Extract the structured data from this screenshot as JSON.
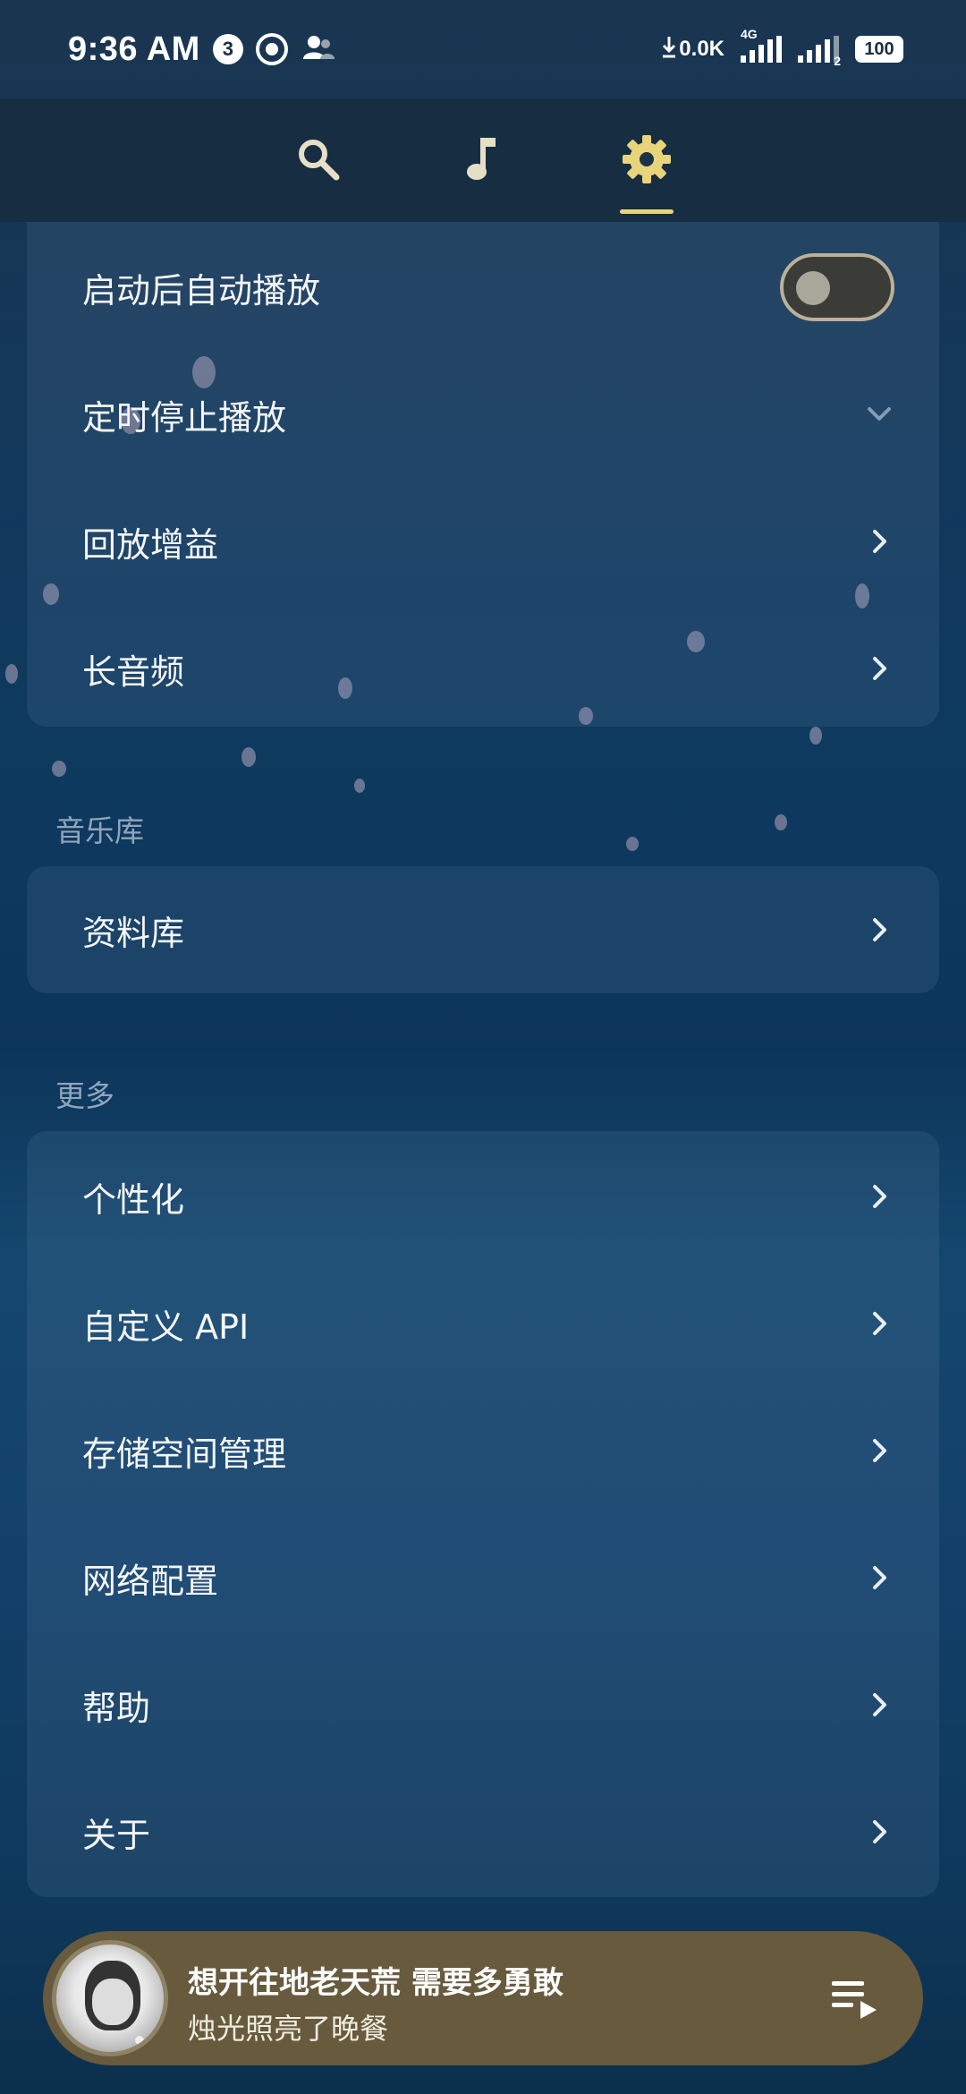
{
  "status_bar": {
    "time": "9:36 AM",
    "notification_count": "3",
    "network_speed": "0.0K",
    "network_type": "4G",
    "sim_slot": "2",
    "battery": "100"
  },
  "nav": {
    "tabs": [
      {
        "name": "search",
        "icon": "search-icon"
      },
      {
        "name": "music",
        "icon": "music-note-icon"
      },
      {
        "name": "settings",
        "icon": "gear-icon",
        "active": true
      }
    ],
    "active_color": "#e8d47a",
    "inactive_color": "#e6dfc6"
  },
  "playback_card": {
    "items": [
      {
        "label": "启动后自动播放",
        "control": "toggle",
        "checked": false
      },
      {
        "label": "定时停止播放",
        "control": "dropdown"
      },
      {
        "label": "回放增益",
        "control": "chevron"
      },
      {
        "label": "长音频",
        "control": "chevron"
      }
    ]
  },
  "library_section": {
    "title": "音乐库",
    "items": [
      {
        "label": "资料库"
      }
    ]
  },
  "more_section": {
    "title": "更多",
    "items": [
      {
        "label": "个性化"
      },
      {
        "label": "自定义 API"
      },
      {
        "label": "存储空间管理"
      },
      {
        "label": "网络配置"
      },
      {
        "label": "帮助"
      },
      {
        "label": "关于"
      }
    ]
  },
  "player": {
    "title": "想开往地老天荒 需要多勇敢",
    "subtitle": "烛光照亮了晚餐",
    "background_color": "#675a3d",
    "queue_icon": "queue-music-icon"
  }
}
